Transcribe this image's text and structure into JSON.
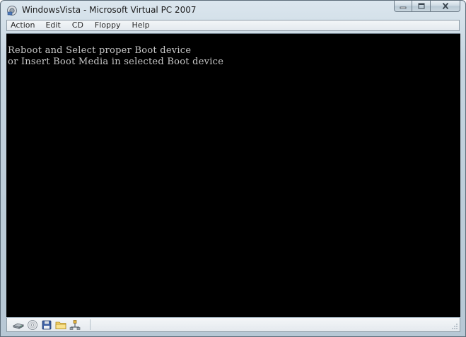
{
  "window": {
    "title": "WindowsVista - Microsoft Virtual PC 2007",
    "app_icon": "virtual-pc-icon",
    "caption_buttons": [
      "minimize-icon",
      "maximize-icon",
      "close-icon"
    ]
  },
  "menubar": {
    "items": [
      {
        "label": "Action"
      },
      {
        "label": "Edit"
      },
      {
        "label": "CD"
      },
      {
        "label": "Floppy"
      },
      {
        "label": "Help"
      }
    ]
  },
  "screen": {
    "background": "#000000",
    "text_color": "#c8c8c8",
    "lines": [
      "Reboot and Select proper Boot device",
      "or Insert Boot Media in selected Boot device"
    ]
  },
  "statusbar": {
    "icons": [
      "hard-disk-icon",
      "cd-drive-icon",
      "floppy-icon",
      "shared-folder-icon",
      "network-icon"
    ]
  }
}
